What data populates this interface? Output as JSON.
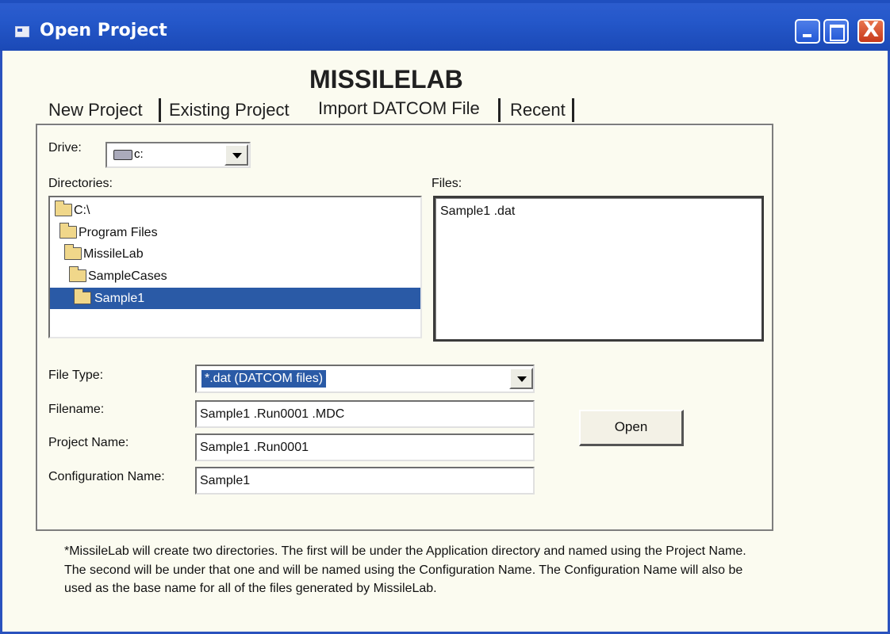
{
  "window": {
    "title": "Open Project",
    "controls": [
      "minimize",
      "maximize",
      "close"
    ],
    "close_glyph": "X"
  },
  "app_title": "MISSILELAB",
  "tabs": [
    {
      "label": "New Project"
    },
    {
      "label": "Existing Project"
    },
    {
      "label": "Import DATCOM File",
      "active": true
    },
    {
      "label": "Recent"
    }
  ],
  "drive": {
    "label": "Drive:",
    "value": "c:",
    "icon": "drive-icon"
  },
  "directories": {
    "label": "Directories:",
    "items": [
      {
        "name": "C:\\",
        "icon": "folder-open-icon"
      },
      {
        "name": "Program Files",
        "icon": "folder-open-icon"
      },
      {
        "name": "MissileLab",
        "icon": "folder-open-icon"
      },
      {
        "name": "SampleCases",
        "icon": "folder-open-icon"
      },
      {
        "name": "Sample1",
        "icon": "folder-open-icon",
        "selected": true
      }
    ]
  },
  "files": {
    "label": "Files:",
    "items": [
      "Sample1 .dat"
    ]
  },
  "form": {
    "file_type_label": "File Type:",
    "file_type_value": "*.dat (DATCOM files)",
    "filename_label": "Filename:",
    "filename_value": "Sample1 .Run0001 .MDC",
    "project_name_label": "Project Name:",
    "project_name_value": "Sample1 .Run0001",
    "configuration_name_label": "Configuration Name:",
    "configuration_name_value": "Sample1"
  },
  "open_button": "Open",
  "note": "*MissileLab will create two directories.  The first will be under the Application directory and named using the Project Name.  The second will be under that one and will be named using the Configuration Name.  The Configuration Name will also be used as the base name for all of the files generated by MissileLab.",
  "colors": {
    "titlebar": "#2457c9",
    "dialog_bg": "#fbfbf0",
    "selection": "#2a5aa6",
    "close_button": "#c6391b"
  }
}
